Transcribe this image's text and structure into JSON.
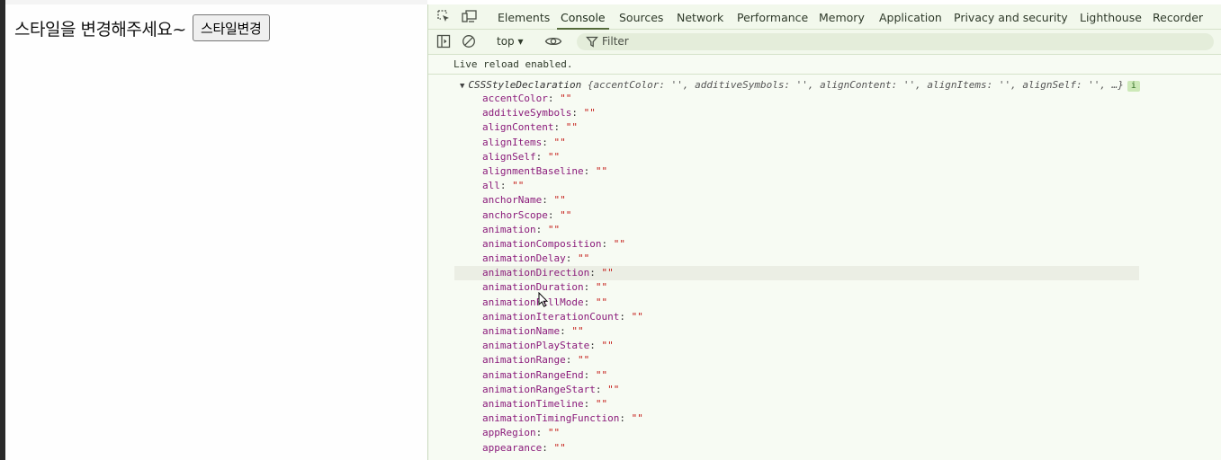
{
  "page": {
    "prompt_text": "스타일을 변경해주세요~",
    "button_label": "스타일변경"
  },
  "devtools": {
    "tabs": [
      "Elements",
      "Console",
      "Sources",
      "Network",
      "Performance",
      "Memory",
      "Application",
      "Privacy and security",
      "Lighthouse",
      "Recorder"
    ],
    "active_tab": "Console",
    "toolbar": {
      "context": "top ▾",
      "filter_placeholder": "Filter"
    },
    "console": {
      "message": "Live reload enabled.",
      "object_class": "CSSStyleDeclaration",
      "object_preview": "{accentColor: '', additiveSymbols: '', alignContent: '', alignItems: '', alignSelf: '', …}",
      "info_badge": "i",
      "hovered_property": "animationDirection",
      "properties": [
        {
          "key": "accentColor",
          "value": "\"\""
        },
        {
          "key": "additiveSymbols",
          "value": "\"\""
        },
        {
          "key": "alignContent",
          "value": "\"\""
        },
        {
          "key": "alignItems",
          "value": "\"\""
        },
        {
          "key": "alignSelf",
          "value": "\"\""
        },
        {
          "key": "alignmentBaseline",
          "value": "\"\""
        },
        {
          "key": "all",
          "value": "\"\""
        },
        {
          "key": "anchorName",
          "value": "\"\""
        },
        {
          "key": "anchorScope",
          "value": "\"\""
        },
        {
          "key": "animation",
          "value": "\"\""
        },
        {
          "key": "animationComposition",
          "value": "\"\""
        },
        {
          "key": "animationDelay",
          "value": "\"\""
        },
        {
          "key": "animationDirection",
          "value": "\"\""
        },
        {
          "key": "animationDuration",
          "value": "\"\""
        },
        {
          "key": "animationFillMode",
          "value": "\"\""
        },
        {
          "key": "animationIterationCount",
          "value": "\"\""
        },
        {
          "key": "animationName",
          "value": "\"\""
        },
        {
          "key": "animationPlayState",
          "value": "\"\""
        },
        {
          "key": "animationRange",
          "value": "\"\""
        },
        {
          "key": "animationRangeEnd",
          "value": "\"\""
        },
        {
          "key": "animationRangeStart",
          "value": "\"\""
        },
        {
          "key": "animationTimeline",
          "value": "\"\""
        },
        {
          "key": "animationTimingFunction",
          "value": "\"\""
        },
        {
          "key": "appRegion",
          "value": "\"\""
        },
        {
          "key": "appearance",
          "value": "\"\""
        }
      ]
    }
  }
}
